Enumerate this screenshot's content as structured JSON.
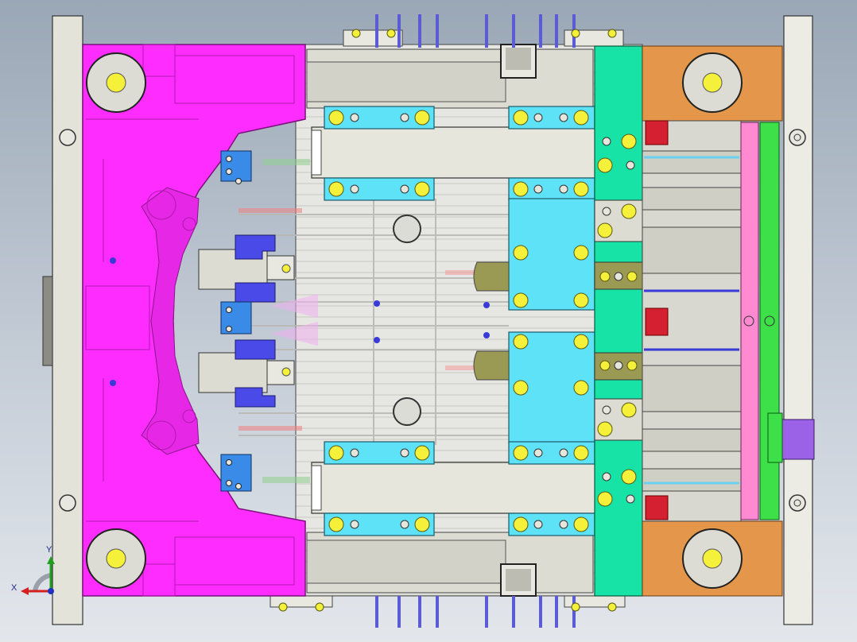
{
  "viewport": {
    "name": "cad-graphics-area",
    "background_top": "#9aa7b6",
    "background_bottom": "#e3e7ec"
  },
  "triad": {
    "x_label": "X",
    "y_label": "Y",
    "x_color": "#d42020",
    "y_color": "#20a020",
    "z_color": "#2030c0"
  },
  "colors": {
    "cavity_plate": "#ff2cff",
    "slide_blocks": "#5de2f7",
    "support_block": "#18e3a6",
    "ejector_plate_pink": "#ff8ad2",
    "ejector_plate_green": "#3ee04a",
    "clamp_plate": "#e8e8e0",
    "spacer_blocks": "#e4964a",
    "wedge_blue": "#4a4ae8",
    "fasteners": "#f5f03a",
    "cooling_lines": "#5b5bd6",
    "stop_pins": "#d42030",
    "purple_bracket": "#9b62e8"
  }
}
